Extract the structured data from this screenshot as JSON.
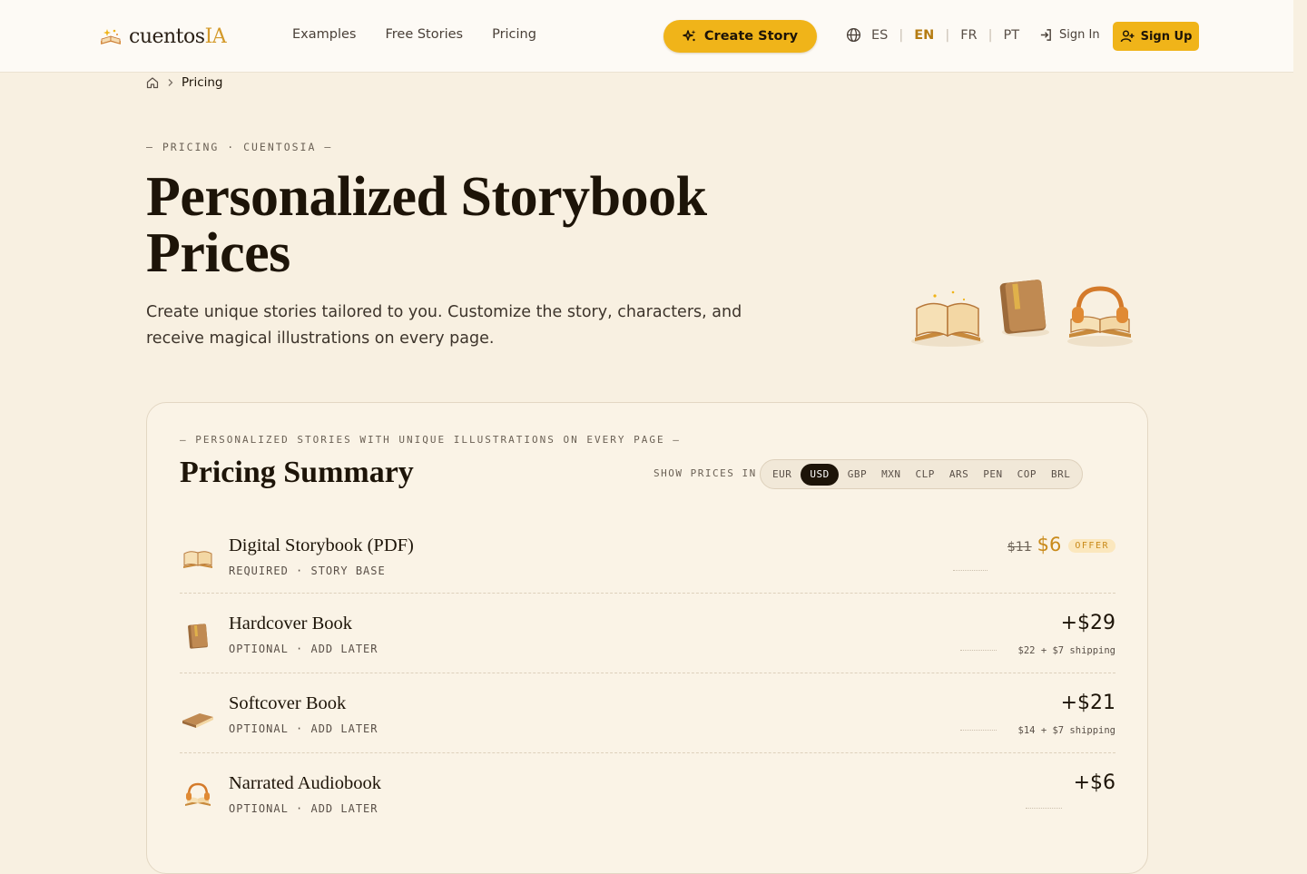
{
  "header": {
    "logo_text": "cuentos",
    "logo_accent": "IA",
    "nav": [
      {
        "label": "Examples"
      },
      {
        "label": "Free Stories"
      },
      {
        "label": "Pricing"
      }
    ],
    "create_label": "Create Story",
    "languages": [
      "ES",
      "EN",
      "FR",
      "PT"
    ],
    "active_language": "EN",
    "signin_label": "Sign In",
    "signup_label": "Sign Up"
  },
  "breadcrumb": {
    "current": "Pricing"
  },
  "hero": {
    "eyebrow": "— PRICING · CUENTOSIA —",
    "title": "Personalized Storybook Prices",
    "subtitle": "Create unique stories tailored to you. Customize the story, characters, and receive magical illustrations on every page."
  },
  "card": {
    "eyebrow": "— PERSONALIZED STORIES WITH UNIQUE ILLUSTRATIONS ON EVERY PAGE —",
    "title": "Pricing Summary",
    "currency_label": "SHOW PRICES IN",
    "currencies": [
      "EUR",
      "USD",
      "GBP",
      "MXN",
      "CLP",
      "ARS",
      "PEN",
      "COP",
      "BRL"
    ],
    "active_currency": "USD",
    "rows": [
      {
        "icon": "open-book-icon",
        "title": "Digital Storybook (PDF)",
        "meta": "REQUIRED · STORY BASE",
        "old_price": "$11",
        "price": "$6",
        "badge": "OFFER",
        "note": ""
      },
      {
        "icon": "hardcover-book-icon",
        "title": "Hardcover Book",
        "meta": "OPTIONAL · ADD LATER",
        "price": "+$29",
        "note": "$22 + $7 shipping"
      },
      {
        "icon": "softcover-book-icon",
        "title": "Softcover Book",
        "meta": "OPTIONAL · ADD LATER",
        "price": "+$21",
        "note": "$14 + $7 shipping"
      },
      {
        "icon": "headphones-book-icon",
        "title": "Narrated Audiobook",
        "meta": "OPTIONAL · ADD LATER",
        "price": "+$6",
        "note": ""
      }
    ]
  },
  "colors": {
    "accent": "#f0b419",
    "offer": "#c98a1a",
    "background": "#f8f0e1",
    "header_bg": "#fdfaf5"
  }
}
